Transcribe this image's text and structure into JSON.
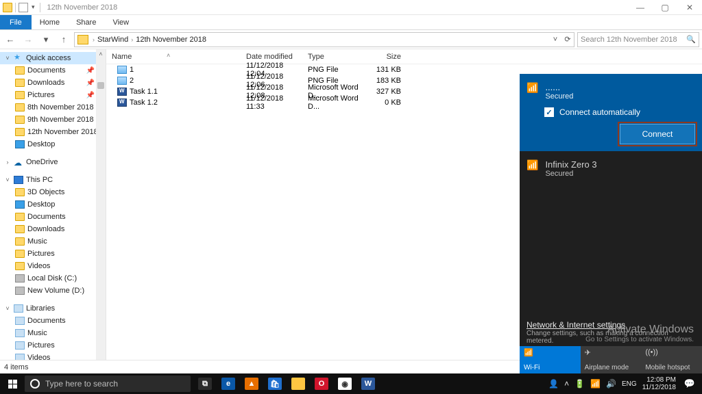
{
  "titlebar": {
    "title": "12th November 2018"
  },
  "winbtns": {
    "min": "—",
    "max": "▢",
    "close": "✕"
  },
  "ribbon": {
    "file": "File",
    "tabs": [
      "Home",
      "Share",
      "View"
    ]
  },
  "nav": {
    "back": "←",
    "forward": "→",
    "dropdown": "▾",
    "up": "↑",
    "refresh": "⟳",
    "addr_dropdown": "˅"
  },
  "breadcrumb": {
    "sep": "›",
    "items": [
      "StarWind",
      "12th November 2018"
    ]
  },
  "search": {
    "placeholder": "Search 12th November 2018",
    "icon": "🔍"
  },
  "tree": {
    "quick": {
      "label": "Quick access",
      "twisty": "˅",
      "children": [
        {
          "label": "Documents",
          "pin": true,
          "ic": "fold"
        },
        {
          "label": "Downloads",
          "pin": true,
          "ic": "fold"
        },
        {
          "label": "Pictures",
          "pin": true,
          "ic": "fold"
        },
        {
          "label": "8th November 2018",
          "ic": "fold"
        },
        {
          "label": "9th November 2018",
          "ic": "fold"
        },
        {
          "label": "12th November 2018",
          "ic": "fold"
        },
        {
          "label": "Desktop",
          "ic": "blue"
        }
      ]
    },
    "onedrive": {
      "label": "OneDrive",
      "twisty": "›"
    },
    "thispc": {
      "label": "This PC",
      "twisty": "˅",
      "children": [
        {
          "label": "3D Objects",
          "ic": "fold"
        },
        {
          "label": "Desktop",
          "ic": "blue"
        },
        {
          "label": "Documents",
          "ic": "fold"
        },
        {
          "label": "Downloads",
          "ic": "fold"
        },
        {
          "label": "Music",
          "ic": "fold"
        },
        {
          "label": "Pictures",
          "ic": "fold"
        },
        {
          "label": "Videos",
          "ic": "fold"
        },
        {
          "label": "Local Disk (C:)",
          "ic": "disk"
        },
        {
          "label": "New Volume (D:)",
          "ic": "disk"
        }
      ]
    },
    "libraries": {
      "label": "Libraries",
      "twisty": "˅",
      "children": [
        {
          "label": "Documents",
          "ic": "lib"
        },
        {
          "label": "Music",
          "ic": "lib"
        },
        {
          "label": "Pictures",
          "ic": "lib"
        },
        {
          "label": "Videos",
          "ic": "lib"
        }
      ]
    }
  },
  "cols": {
    "name": "Name",
    "date": "Date modified",
    "type": "Type",
    "size": "Size"
  },
  "files": [
    {
      "name": "1",
      "date": "11/12/2018 12:04",
      "type": "PNG File",
      "size": "131 KB",
      "ic": "png"
    },
    {
      "name": "2",
      "date": "11/12/2018 12:06",
      "type": "PNG File",
      "size": "183 KB",
      "ic": "png"
    },
    {
      "name": "Task 1.1",
      "date": "11/12/2018 12:08",
      "type": "Microsoft Word D...",
      "size": "327 KB",
      "ic": "doc"
    },
    {
      "name": "Task 1.2",
      "date": "11/12/2018 11:33",
      "type": "Microsoft Word D...",
      "size": "0 KB",
      "ic": "doc"
    }
  ],
  "status": {
    "text": "4 items"
  },
  "wifi": {
    "nets": [
      {
        "name": "......",
        "secured": "Secured",
        "active": true
      },
      {
        "name": "Infinix Zero 3",
        "secured": "Secured",
        "active": false
      }
    ],
    "auto_label": "Connect automatically",
    "connect": "Connect",
    "settings_title": "Network & Internet settings",
    "settings_sub": "Change settings, such as making a connection metered.",
    "watermark1": "Activate Windows",
    "watermark2": "Go to Settings to activate Windows.",
    "tiles": [
      {
        "label": "Wi-Fi",
        "icon": "📶",
        "on": true
      },
      {
        "label": "Airplane mode",
        "icon": "✈",
        "on": false
      },
      {
        "label": "Mobile hotspot",
        "icon": "((•))",
        "on": false
      }
    ]
  },
  "taskbar": {
    "search_placeholder": "Type here to search",
    "apps": [
      {
        "name": "task-view",
        "bg": "#2b2b2b",
        "txt": "⧉"
      },
      {
        "name": "edge",
        "bg": "#0a58a8",
        "txt": "e"
      },
      {
        "name": "vlc",
        "bg": "#e76e00",
        "txt": "▲"
      },
      {
        "name": "store",
        "bg": "#1f6fcf",
        "txt": "🛍"
      },
      {
        "name": "explorer",
        "bg": "#ffc642",
        "txt": ""
      },
      {
        "name": "opera",
        "bg": "#d1152c",
        "txt": "O"
      },
      {
        "name": "chrome",
        "bg": "#ffffff",
        "txt": "◉"
      },
      {
        "name": "word",
        "bg": "#2b579a",
        "txt": "W"
      }
    ],
    "tray": {
      "people": "👤",
      "chev": "˄",
      "batt": "🔋",
      "wifi": "📶",
      "vol": "🔊",
      "lang": "ENG",
      "time": "12:08 PM",
      "date": "11/12/2018",
      "notif": "💬"
    }
  }
}
